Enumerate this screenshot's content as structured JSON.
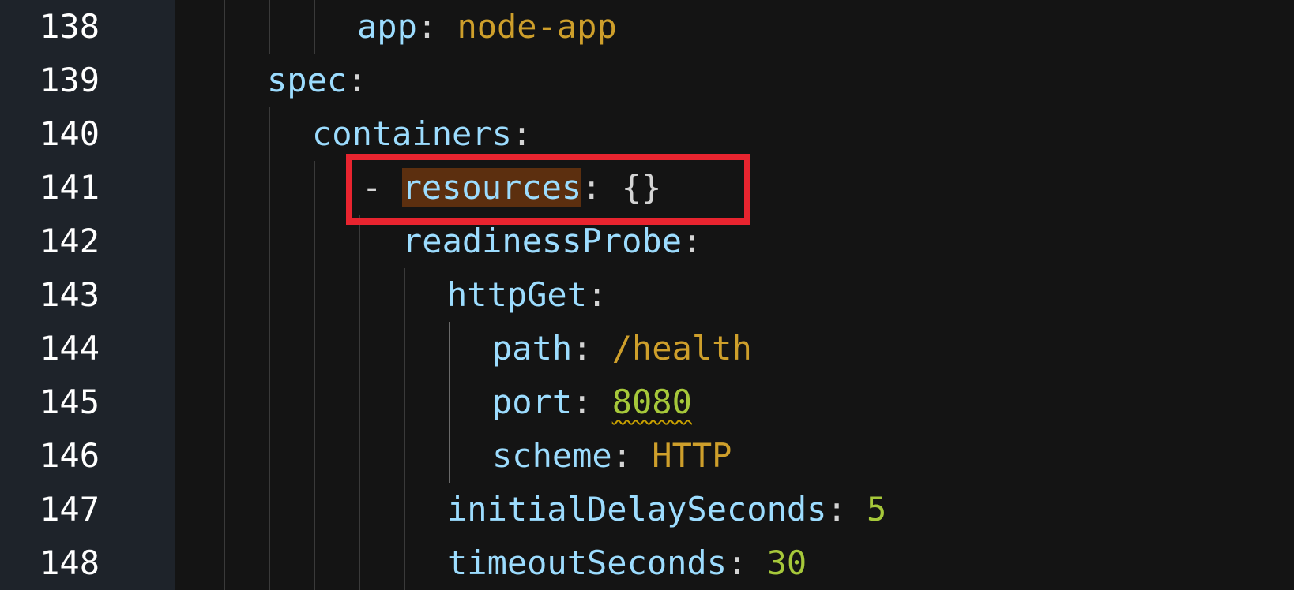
{
  "editor": {
    "lines": [
      {
        "num": "138",
        "tokens": [
          {
            "t": "app",
            "c": "key"
          },
          {
            "t": ": ",
            "c": "punc"
          },
          {
            "t": "node-app",
            "c": "str"
          }
        ]
      },
      {
        "num": "139",
        "tokens": [
          {
            "t": "spec",
            "c": "key"
          },
          {
            "t": ":",
            "c": "punc"
          }
        ]
      },
      {
        "num": "140",
        "tokens": [
          {
            "t": "containers",
            "c": "key"
          },
          {
            "t": ":",
            "c": "punc"
          }
        ]
      },
      {
        "num": "141",
        "tokens": [
          {
            "t": "- ",
            "c": "dash"
          },
          {
            "t": "resources",
            "c": "key hl-word"
          },
          {
            "t": ": {}",
            "c": "punc"
          }
        ]
      },
      {
        "num": "142",
        "tokens": [
          {
            "t": "readinessProbe",
            "c": "key"
          },
          {
            "t": ":",
            "c": "punc"
          }
        ]
      },
      {
        "num": "143",
        "tokens": [
          {
            "t": "httpGet",
            "c": "key"
          },
          {
            "t": ":",
            "c": "punc"
          }
        ]
      },
      {
        "num": "144",
        "tokens": [
          {
            "t": "path",
            "c": "key"
          },
          {
            "t": ": ",
            "c": "punc"
          },
          {
            "t": "/health",
            "c": "str"
          }
        ]
      },
      {
        "num": "145",
        "tokens": [
          {
            "t": "port",
            "c": "key"
          },
          {
            "t": ": ",
            "c": "punc"
          },
          {
            "t": "8080",
            "c": "numgreen squiggle"
          }
        ]
      },
      {
        "num": "146",
        "tokens": [
          {
            "t": "scheme",
            "c": "key"
          },
          {
            "t": ": ",
            "c": "punc"
          },
          {
            "t": "HTTP",
            "c": "str"
          }
        ]
      },
      {
        "num": "147",
        "tokens": [
          {
            "t": "initialDelaySeconds",
            "c": "key"
          },
          {
            "t": ": ",
            "c": "punc"
          },
          {
            "t": "5",
            "c": "numgreen"
          }
        ]
      },
      {
        "num": "148",
        "tokens": [
          {
            "t": "timeoutSeconds",
            "c": "key"
          },
          {
            "t": ": ",
            "c": "punc"
          },
          {
            "t": "30",
            "c": "numgreen"
          }
        ]
      }
    ]
  },
  "colors": {
    "background": "#141414",
    "gutter": "#1e232a",
    "key": "#9cdcfe",
    "string": "#ce9f2b",
    "number": "#a6c83a",
    "highlight_box": "#e8242f",
    "word_highlight": "#5c2f0f"
  }
}
